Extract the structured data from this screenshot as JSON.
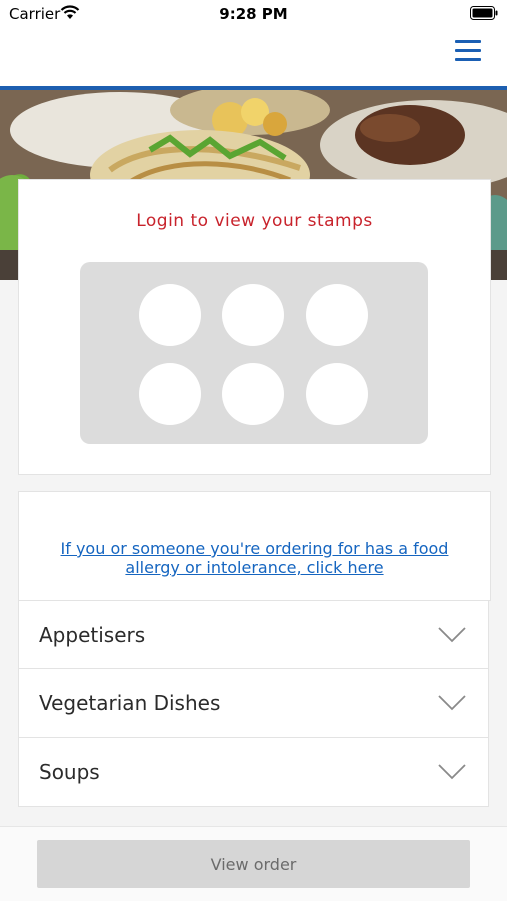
{
  "status_bar": {
    "carrier": "Carrier",
    "time": "9:28 PM",
    "icons": [
      "wifi-icon",
      "battery-icon"
    ]
  },
  "nav": {
    "menu_icon": "hamburger-menu-icon",
    "accent_color": "#1d5fb0"
  },
  "hero": {
    "image": "food-photo"
  },
  "stamps": {
    "title": "Login to view your stamps",
    "title_color": "#c8232c",
    "stamp_count": 6
  },
  "allergy": {
    "link_text": "If you or someone you're ordering for has a food allergy or intolerance, click here",
    "link_color": "#1565c0"
  },
  "categories": [
    {
      "label": "Appetisers",
      "icon": "chevron-down-icon"
    },
    {
      "label": "Vegetarian Dishes",
      "icon": "chevron-down-icon"
    },
    {
      "label": "Soups",
      "icon": "chevron-down-icon"
    }
  ],
  "footer": {
    "view_order_label": "View order"
  }
}
